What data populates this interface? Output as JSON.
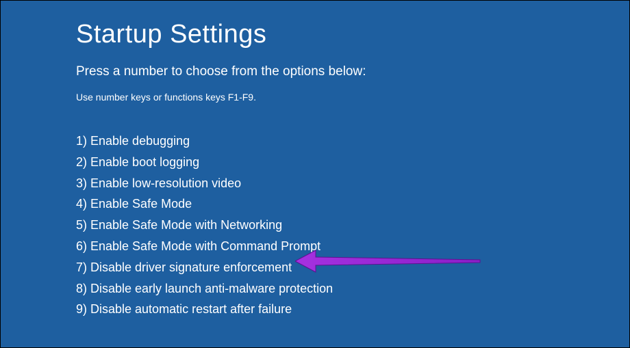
{
  "title": "Startup Settings",
  "subtitle": "Press a number to choose from the options below:",
  "instruction": "Use number keys or functions keys F1-F9.",
  "options": [
    "1) Enable debugging",
    "2) Enable boot logging",
    "3) Enable low-resolution video",
    "4) Enable Safe Mode",
    "5) Enable Safe Mode with Networking",
    "6) Enable Safe Mode with Command Prompt",
    "7) Disable driver signature enforcement",
    "8) Disable early launch anti-malware protection",
    "9) Disable automatic restart after failure"
  ],
  "annotation": {
    "color": "#9b2fd9",
    "target_index": 6
  }
}
